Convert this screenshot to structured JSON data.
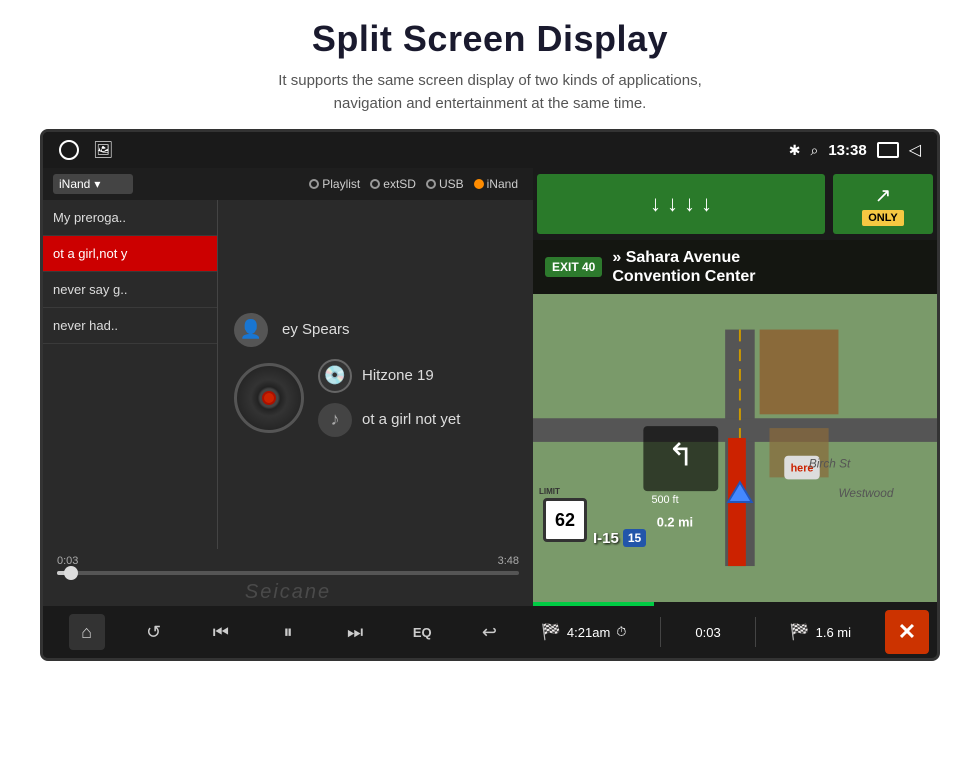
{
  "header": {
    "title": "Split Screen Display",
    "subtitle_line1": "It supports the same screen display of two kinds of applications,",
    "subtitle_line2": "navigation and entertainment at the same time."
  },
  "status_bar": {
    "bluetooth_icon": "bluetooth",
    "location_icon": "location",
    "time": "13:38",
    "screen_icon": "screen",
    "back_icon": "back"
  },
  "music_panel": {
    "source_dropdown_label": "iNand",
    "source_options": [
      {
        "label": "Playlist",
        "active": false
      },
      {
        "label": "extSD",
        "active": false
      },
      {
        "label": "USB",
        "active": false
      },
      {
        "label": "iNand",
        "active": true
      }
    ],
    "playlist": [
      {
        "label": "My preroga..",
        "active": false
      },
      {
        "label": "ot a girl,not y",
        "active": true
      },
      {
        "label": "never say g..",
        "active": false
      },
      {
        "label": "never had..",
        "active": false
      }
    ],
    "now_playing": {
      "artist": "ey Spears",
      "album": "Hitzone 19",
      "track": "ot a girl not yet"
    },
    "progress": {
      "current": "0:03",
      "total": "3:48",
      "percent": 3
    },
    "watermark": "Seicane",
    "controls": [
      {
        "name": "home",
        "icon": "⌂"
      },
      {
        "name": "repeat",
        "icon": "↺"
      },
      {
        "name": "prev",
        "icon": "⏮"
      },
      {
        "name": "play-pause",
        "icon": "⏸"
      },
      {
        "name": "next",
        "icon": "⏭"
      },
      {
        "name": "eq",
        "icon": "EQ"
      },
      {
        "name": "back",
        "icon": "↩"
      }
    ]
  },
  "nav_panel": {
    "sign_arrows": [
      "↓",
      "↓",
      "↓",
      "↓"
    ],
    "sign_only": "ONLY",
    "exit_badge": "EXIT 40",
    "direction_line1": "» Sahara Avenue",
    "direction_line2": "Convention Center",
    "distance_line": "0.2 mi",
    "speed_limit": "62",
    "highway_label": "I-15",
    "highway_number": "15",
    "bottom_time": "4:21am",
    "bottom_elapsed": "0:03",
    "bottom_distance": "1.6 mi"
  }
}
